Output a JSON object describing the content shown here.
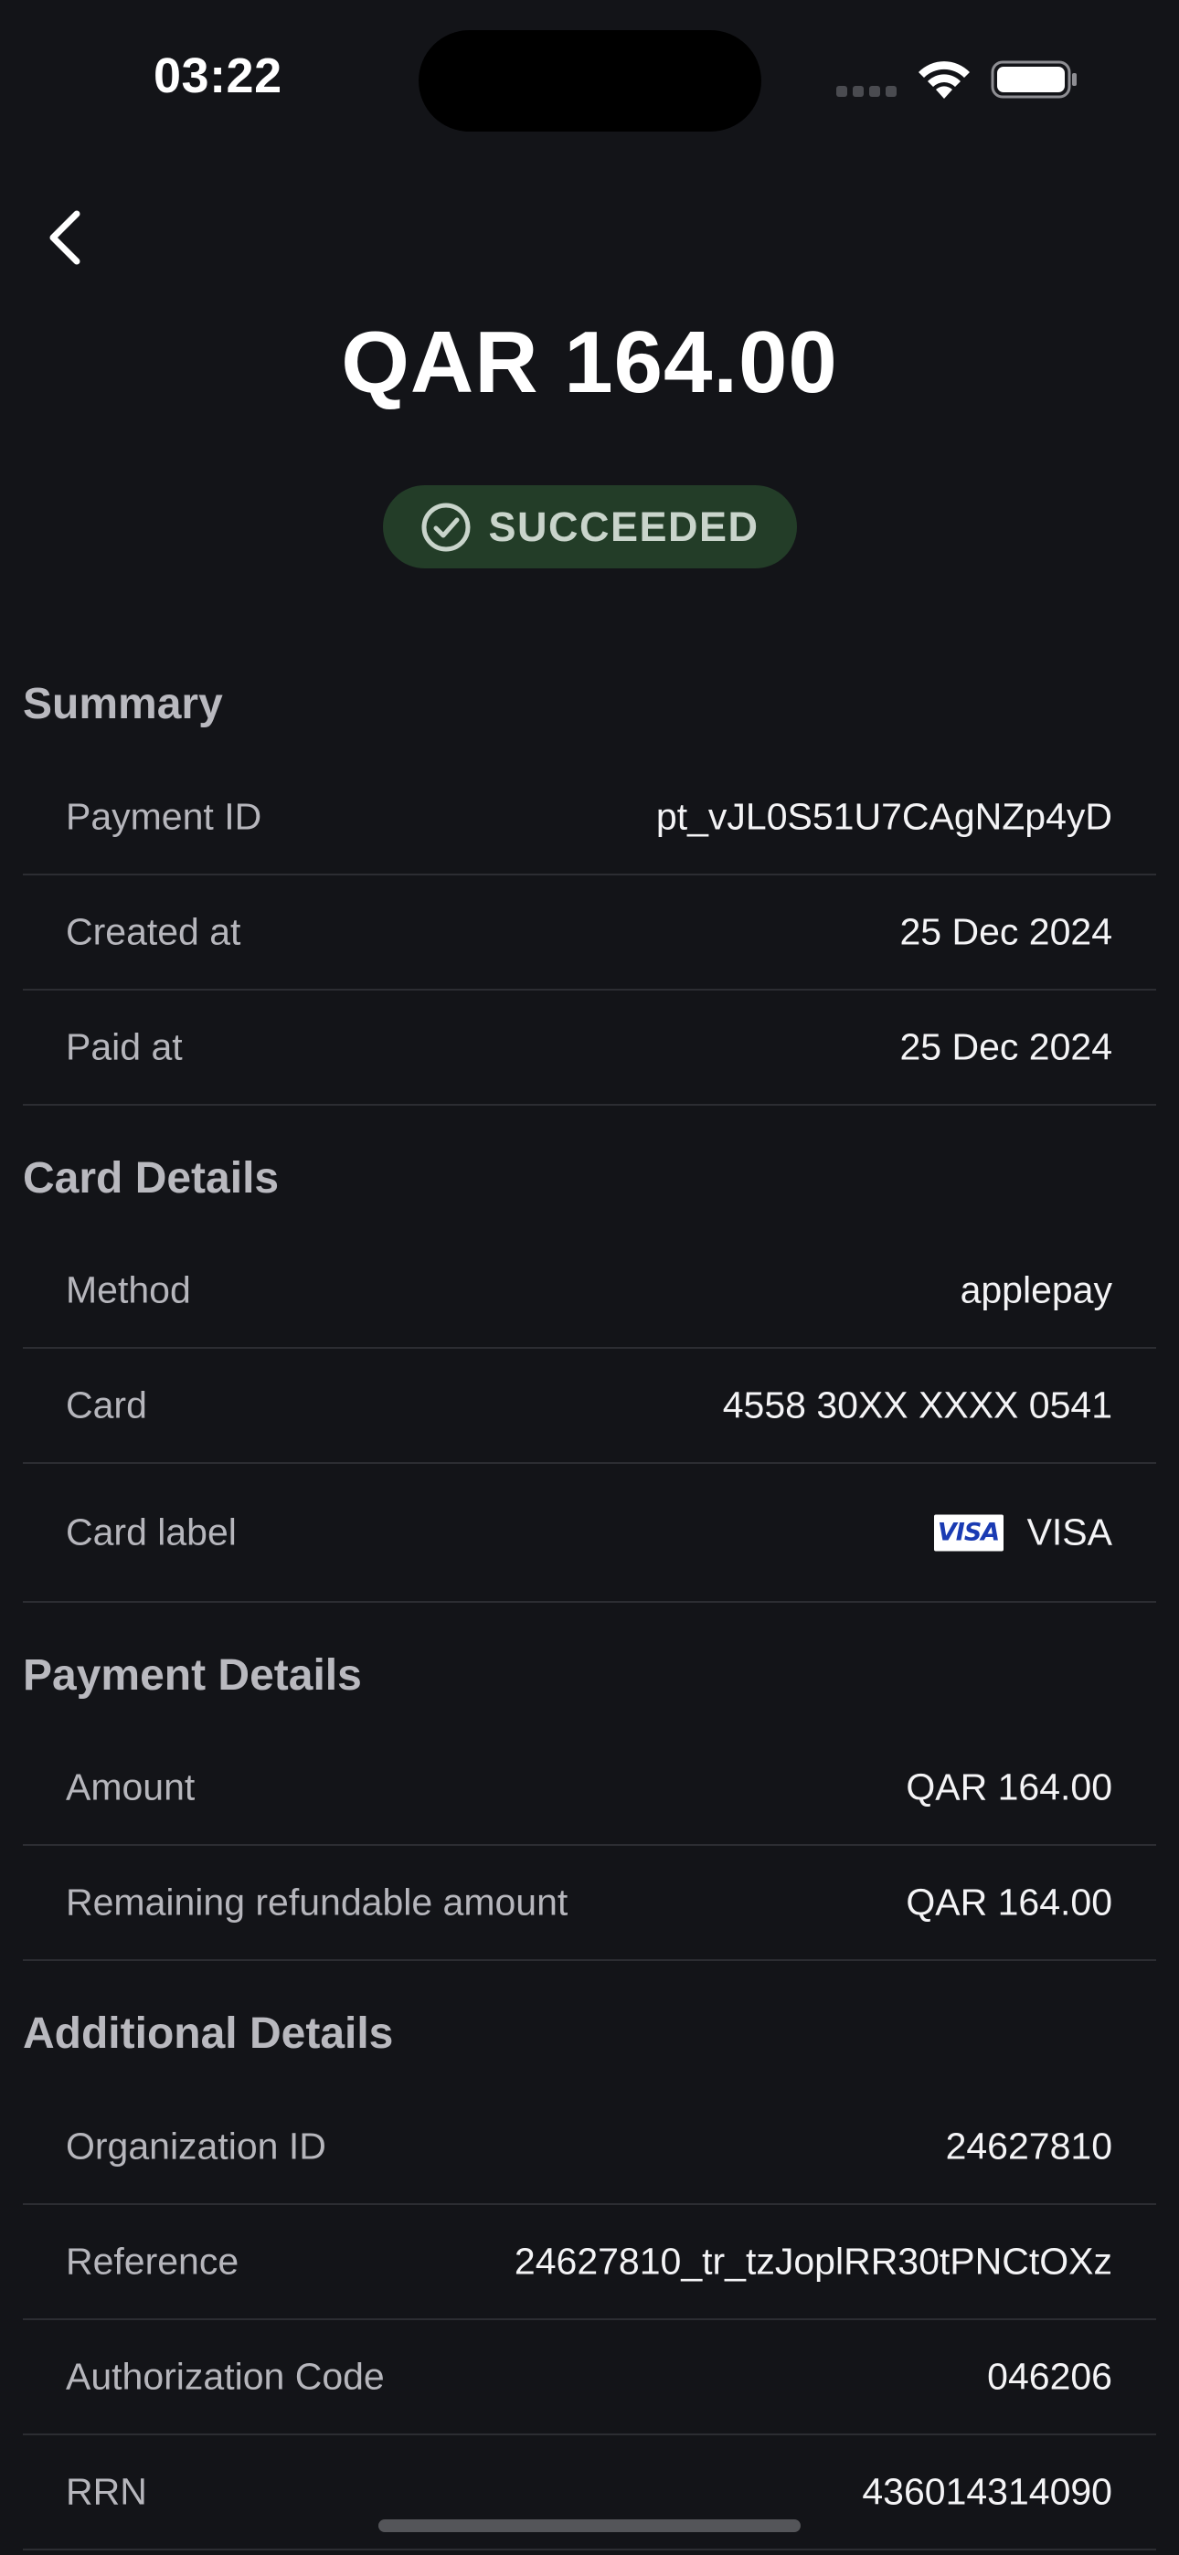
{
  "status_bar": {
    "time": "03:22"
  },
  "header": {
    "amount": "QAR 164.00",
    "status": "SUCCEEDED"
  },
  "colors": {
    "background": "#131418",
    "badge_background": "#233d28",
    "badge_text": "#c9d4cb"
  },
  "sections": {
    "summary": {
      "title": "Summary",
      "rows": [
        {
          "label": "Payment ID",
          "value": "pt_vJL0S51U7CAgNZp4yD"
        },
        {
          "label": "Created at",
          "value": "25 Dec 2024"
        },
        {
          "label": "Paid at",
          "value": "25 Dec 2024"
        }
      ]
    },
    "card_details": {
      "title": "Card Details",
      "rows": [
        {
          "label": "Method",
          "value": "applepay"
        },
        {
          "label": "Card",
          "value": "4558 30XX XXXX 0541"
        },
        {
          "label": "Card label",
          "value": "VISA",
          "logo_text": "VISA",
          "icon": "visa-logo-icon"
        }
      ]
    },
    "payment_details": {
      "title": "Payment Details",
      "rows": [
        {
          "label": "Amount",
          "value": "QAR 164.00"
        },
        {
          "label": "Remaining refundable amount",
          "value": "QAR 164.00"
        }
      ]
    },
    "additional_details": {
      "title": "Additional Details",
      "rows": [
        {
          "label": "Organization ID",
          "value": "24627810"
        },
        {
          "label": "Reference",
          "value": "24627810_tr_tzJoplRR30tPNCtOXz"
        },
        {
          "label": "Authorization Code",
          "value": "046206"
        },
        {
          "label": "RRN",
          "value": "436014314090"
        }
      ]
    }
  }
}
